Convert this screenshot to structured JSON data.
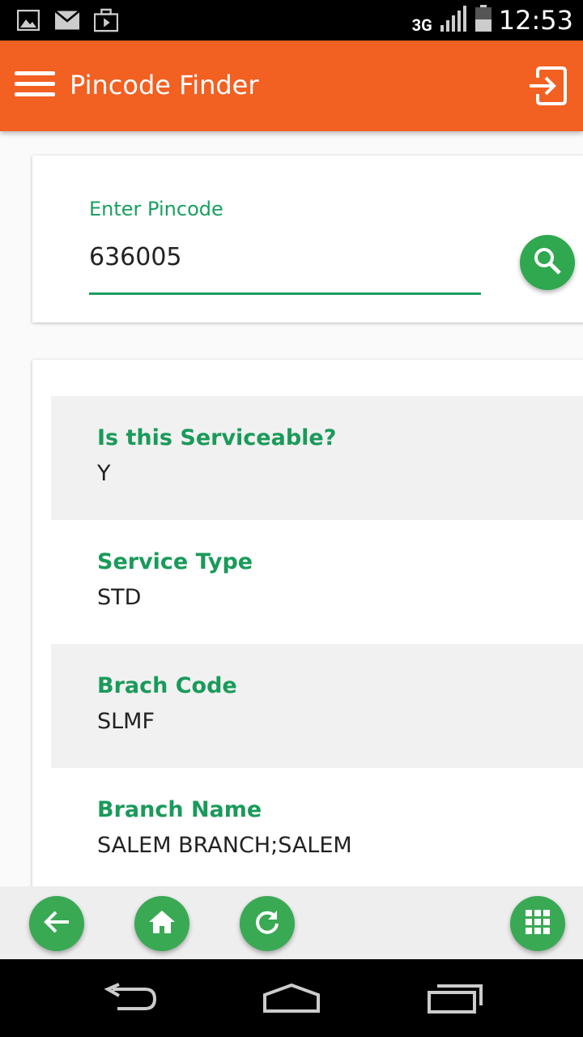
{
  "status_bar": {
    "network": "3G",
    "time": "12:53",
    "icons": [
      "image-icon",
      "mail-icon",
      "briefcase-icon",
      "signal-icon",
      "battery-icon"
    ]
  },
  "app_bar": {
    "title": "Pincode Finder",
    "background": "#f26022",
    "icons": [
      "menu-icon",
      "logout-icon"
    ]
  },
  "search": {
    "label": "Enter Pincode",
    "value": "636005",
    "accent": "#1aa061",
    "button_icon": "search-icon"
  },
  "results": [
    {
      "label": "Is this Serviceable?",
      "value": "Y"
    },
    {
      "label": "Service Type",
      "value": "STD"
    },
    {
      "label": "Brach Code",
      "value": "SLMF"
    },
    {
      "label": "Branch Name",
      "value": "SALEM BRANCH;SALEM"
    }
  ],
  "bottom_bar": {
    "buttons": [
      "back-arrow-icon",
      "home-icon",
      "refresh-icon",
      "grid-menu-icon"
    ],
    "color": "#3aa954"
  },
  "system_nav": {
    "buttons": [
      "back-icon",
      "home-outline-icon",
      "recents-icon"
    ]
  }
}
